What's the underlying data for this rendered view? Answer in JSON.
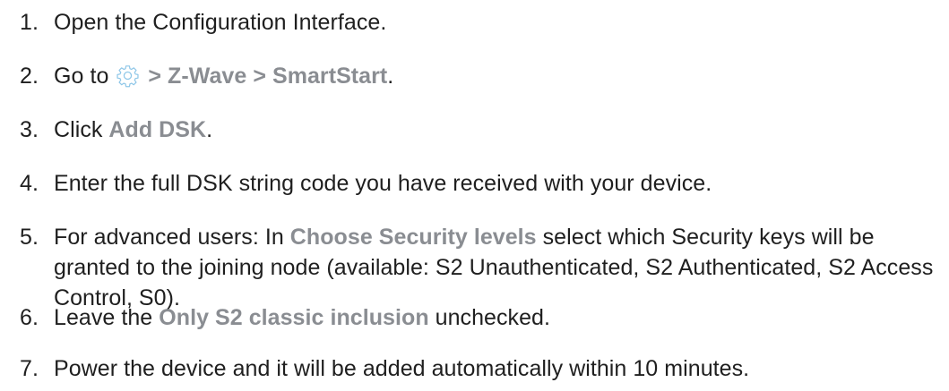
{
  "steps": [
    {
      "num": "1.",
      "parts": {
        "t1": "Open the Configuration Interface."
      }
    },
    {
      "num": "2.",
      "parts": {
        "t1": "Go to ",
        "t2": " > Z-Wave > SmartStart",
        "t3": "."
      },
      "icon": "gear-icon"
    },
    {
      "num": "3.",
      "parts": {
        "t1": "Click ",
        "h1": "Add DSK",
        "t2": "."
      }
    },
    {
      "num": "4.",
      "parts": {
        "t1": "Enter the full DSK string code you have received with your device."
      }
    },
    {
      "num": "5.",
      "parts": {
        "t1": "For advanced users: In ",
        "h1": "Choose Security levels",
        "t2": " select which Security keys will be granted to the joining node (available: S2 Unauthenticated, S2 Authenticated, S2 Access Control, S0)."
      }
    },
    {
      "num": "6.",
      "parts": {
        "t1": "Leave the ",
        "h1": "Only S2 classic inclusion",
        "t2": " unchecked."
      }
    },
    {
      "num": "7.",
      "parts": {
        "t1": "Power the device and it will be added automatically within 10 minutes."
      }
    }
  ],
  "colors": {
    "text": "#1f1f1f",
    "highlight": "#8a8d92",
    "icon": "#8fc7e8"
  }
}
